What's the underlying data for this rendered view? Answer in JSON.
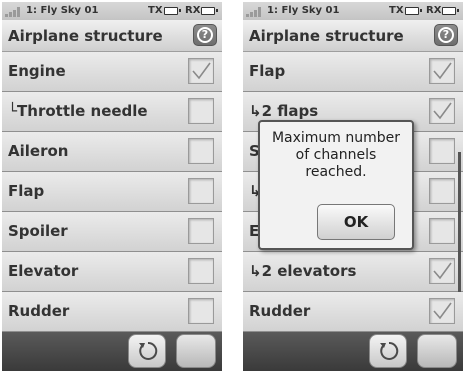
{
  "left_screen": {
    "status": {
      "model": "1: Fly Sky 01",
      "tx_label": "TX",
      "rx_label": "RX"
    },
    "title": "Airplane structure",
    "help_glyph": "?",
    "rows": [
      {
        "label": "Engine",
        "checked": true
      },
      {
        "label": "└Throttle needle",
        "checked": false
      },
      {
        "label": "Aileron",
        "checked": false
      },
      {
        "label": "Flap",
        "checked": false
      },
      {
        "label": "Spoiler",
        "checked": false
      },
      {
        "label": "Elevator",
        "checked": false
      },
      {
        "label": "Rudder",
        "checked": false
      }
    ]
  },
  "right_screen": {
    "status": {
      "model": "1: Fly Sky 01",
      "tx_label": "TX",
      "rx_label": "RX"
    },
    "title": "Airplane structure",
    "help_glyph": "?",
    "rows": [
      {
        "label": "Flap",
        "checked": true
      },
      {
        "label": "↳2 flaps",
        "checked": true
      },
      {
        "label": "S",
        "checked": false
      },
      {
        "label": "↳",
        "checked": false
      },
      {
        "label": "E",
        "checked": false
      },
      {
        "label": "↳2 elevators",
        "checked": true
      },
      {
        "label": "Rudder",
        "checked": true
      }
    ],
    "dialog": {
      "line1": "Maximum number",
      "line2": "of channels",
      "line3": "reached.",
      "ok_label": "OK"
    }
  },
  "icons": {
    "signal": "signal-strength-icon",
    "battery": "battery-icon",
    "help": "help-icon",
    "back": "back-rotate-icon",
    "check": "checkmark-icon"
  },
  "colors": {
    "accent": "#6e6e6e",
    "bottom_bar": "#3a3a3a",
    "row_bg": "#e0e0e0"
  }
}
